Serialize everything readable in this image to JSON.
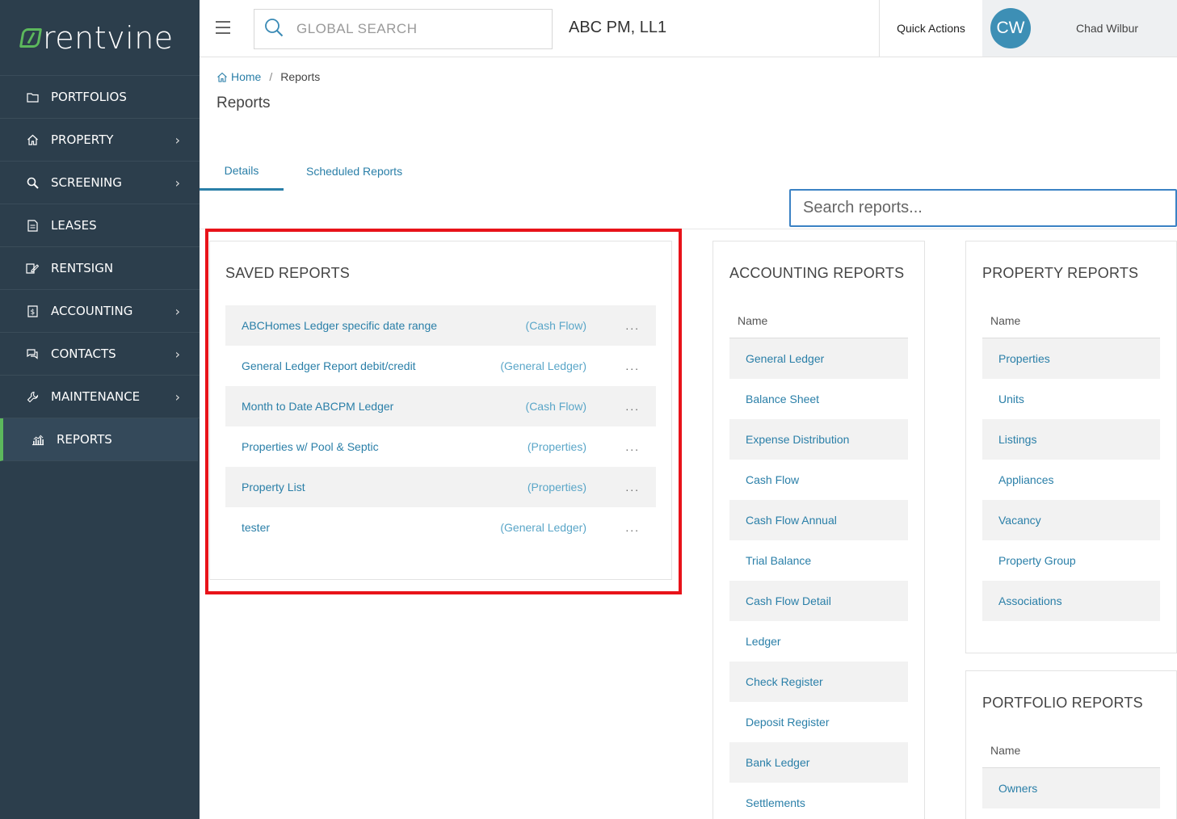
{
  "brand": {
    "name": "rentvine",
    "accent": "#5cb85c",
    "sidebar_bg": "#2c3e4c",
    "link": "#2a7fa8"
  },
  "sidebar": {
    "items": [
      {
        "label": "PORTFOLIOS",
        "icon": "folder-icon",
        "chevron": false
      },
      {
        "label": "PROPERTY",
        "icon": "home-icon",
        "chevron": true
      },
      {
        "label": "SCREENING",
        "icon": "magnify-icon",
        "chevron": true
      },
      {
        "label": "LEASES",
        "icon": "document-icon",
        "chevron": false
      },
      {
        "label": "RENTSIGN",
        "icon": "sign-icon",
        "chevron": false
      },
      {
        "label": "ACCOUNTING",
        "icon": "dollar-doc-icon",
        "chevron": true
      },
      {
        "label": "CONTACTS",
        "icon": "chat-icon",
        "chevron": true
      },
      {
        "label": "MAINTENANCE",
        "icon": "wrench-icon",
        "chevron": true
      },
      {
        "label": "REPORTS",
        "icon": "chart-icon",
        "chevron": false,
        "active": true
      }
    ]
  },
  "header": {
    "search_placeholder": "GLOBAL SEARCH",
    "company": "ABC PM, LL1",
    "quick_actions": "Quick Actions",
    "avatar_initials": "CW",
    "user_name": "Chad Wilbur"
  },
  "breadcrumb": {
    "home": "Home",
    "separator": "/",
    "current": "Reports"
  },
  "page_title": "Reports",
  "tabs": {
    "details": "Details",
    "scheduled": "Scheduled Reports",
    "active": "Details"
  },
  "report_search_placeholder": "Search reports...",
  "saved_reports": {
    "title": "SAVED REPORTS",
    "more": "...",
    "rows": [
      {
        "name": "ABCHomes Ledger specific date range",
        "type": "(Cash Flow)"
      },
      {
        "name": "General Ledger Report debit/credit",
        "type": "(General Ledger)"
      },
      {
        "name": "Month to Date ABCPM Ledger",
        "type": "(Cash Flow)"
      },
      {
        "name": "Properties w/ Pool & Septic",
        "type": "(Properties)"
      },
      {
        "name": "Property List",
        "type": "(Properties)"
      },
      {
        "name": "tester",
        "type": "(General Ledger)"
      }
    ]
  },
  "accounting_reports": {
    "title": "ACCOUNTING REPORTS",
    "column": "Name",
    "rows": [
      "General Ledger",
      "Balance Sheet",
      "Expense Distribution",
      "Cash Flow",
      "Cash Flow Annual",
      "Trial Balance",
      "Cash Flow Detail",
      "Ledger",
      "Check Register",
      "Deposit Register",
      "Bank Ledger",
      "Settlements"
    ]
  },
  "property_reports": {
    "title": "PROPERTY REPORTS",
    "column": "Name",
    "rows": [
      "Properties",
      "Units",
      "Listings",
      "Appliances",
      "Vacancy",
      "Property Group",
      "Associations"
    ]
  },
  "portfolio_reports": {
    "title": "PORTFOLIO REPORTS",
    "column": "Name",
    "rows": [
      "Owners"
    ]
  }
}
